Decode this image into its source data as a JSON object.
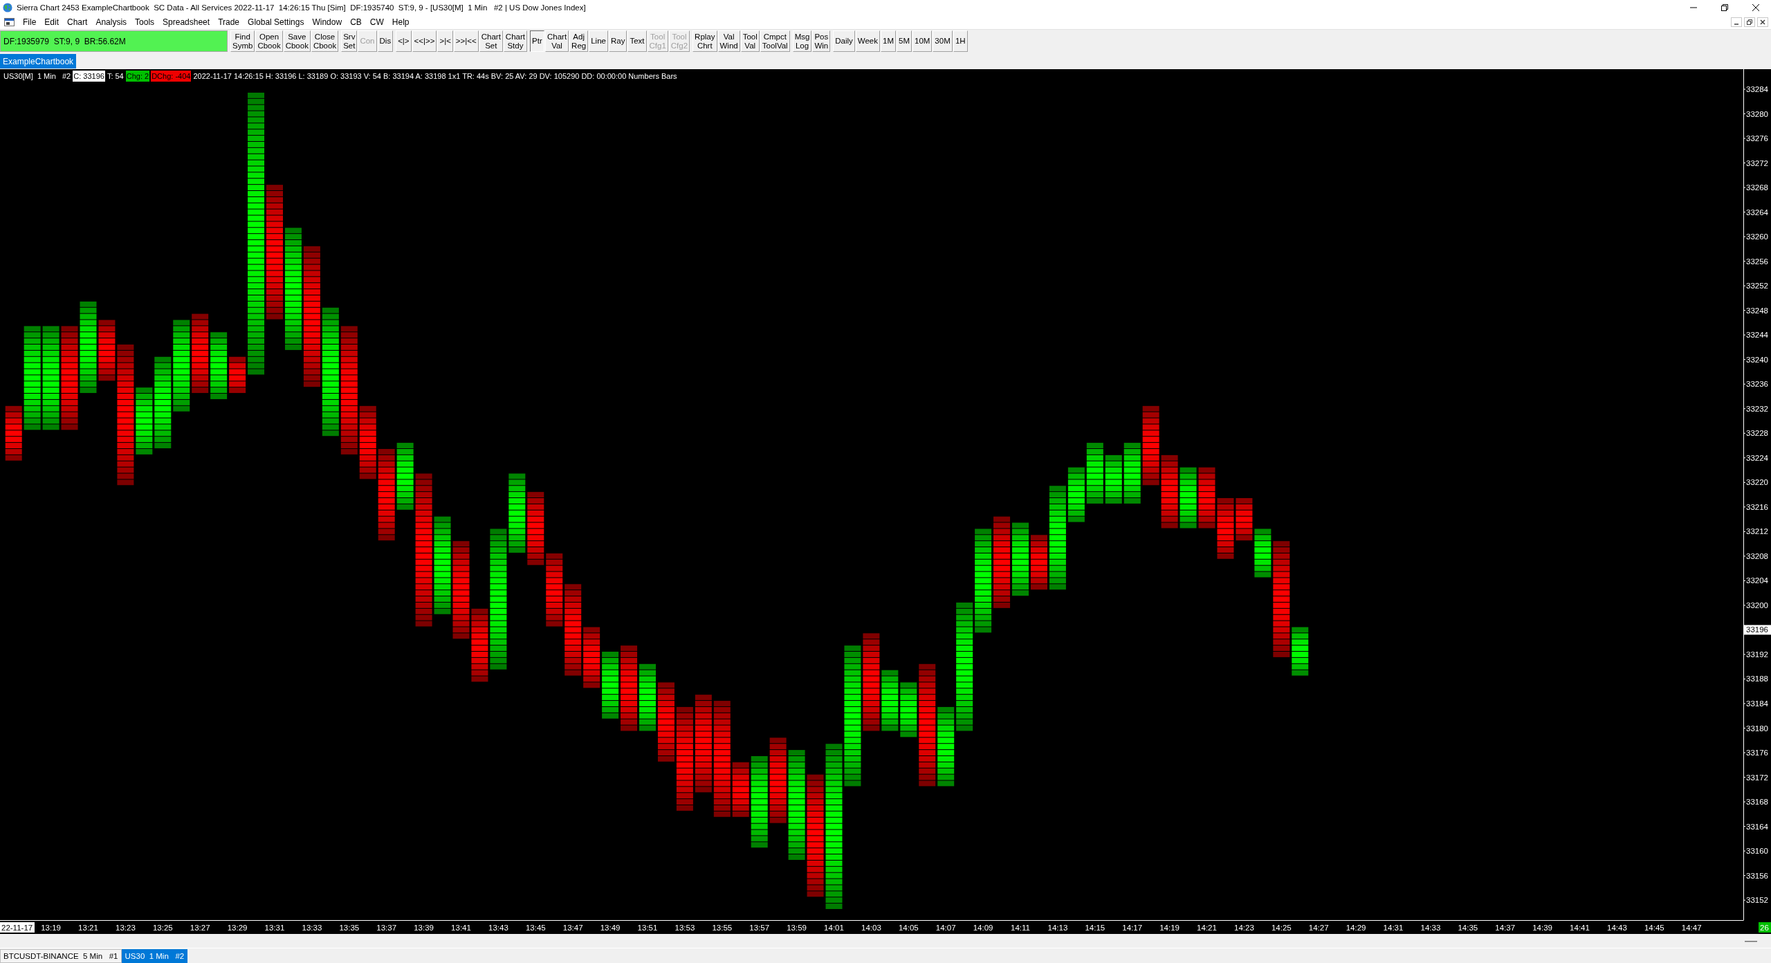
{
  "window": {
    "title": "Sierra Chart 2453 ExampleChartbook  SC Data - All Services 2022-11-17  14:26:15 Thu [Sim]  DF:1935740  ST:9, 9 - [US30[M]  1 Min   #2 | US Dow Jones Index]"
  },
  "menu_bar": [
    "File",
    "Edit",
    "Chart",
    "Analysis",
    "Tools",
    "Spreadsheet",
    "Trade",
    "Global Settings",
    "Window",
    "CB",
    "CW",
    "Help"
  ],
  "toolbar": {
    "status": "DF:1935979  ST:9, 9  BR:56.62M",
    "groups": [
      {
        "buttons": [
          {
            "label": "Find\nSymb",
            "selected": false,
            "disabled": false
          },
          {
            "label": "Open\nCbook",
            "selected": false,
            "disabled": false
          },
          {
            "label": "Save\nCbook",
            "selected": false,
            "disabled": false
          },
          {
            "label": "Close\nCbook",
            "selected": false,
            "disabled": false
          }
        ]
      },
      {
        "buttons": [
          {
            "label": "Srv\nSet",
            "selected": false,
            "disabled": false
          },
          {
            "label": "Con",
            "selected": false,
            "disabled": true
          },
          {
            "label": "Dis",
            "selected": false,
            "disabled": false
          }
        ]
      },
      {
        "buttons": [
          {
            "label": "<|>",
            "selected": false,
            "disabled": false
          },
          {
            "label": "<<|>>",
            "selected": false,
            "disabled": false
          },
          {
            "label": ">|<",
            "selected": false,
            "disabled": false
          },
          {
            "label": ">>|<<",
            "selected": false,
            "disabled": false
          },
          {
            "label": "Chart\nSet",
            "selected": false,
            "disabled": false
          },
          {
            "label": "Chart\nStdy",
            "selected": false,
            "disabled": false
          }
        ]
      },
      {
        "buttons": [
          {
            "label": "Ptr",
            "selected": true,
            "disabled": false
          },
          {
            "label": "Chart\nVal",
            "selected": false,
            "disabled": false
          },
          {
            "label": "Adj\nReg",
            "selected": false,
            "disabled": false
          },
          {
            "label": "Line",
            "selected": false,
            "disabled": false
          },
          {
            "label": "Ray",
            "selected": false,
            "disabled": false
          },
          {
            "label": "Text",
            "selected": false,
            "disabled": false
          },
          {
            "label": "Tool\nCfg1",
            "selected": false,
            "disabled": true
          },
          {
            "label": "Tool\nCfg2",
            "selected": false,
            "disabled": true
          }
        ]
      },
      {
        "buttons": [
          {
            "label": "Rplay\nChrt",
            "selected": false,
            "disabled": false
          },
          {
            "label": "Val\nWind",
            "selected": false,
            "disabled": false
          },
          {
            "label": "Tool\nVal",
            "selected": false,
            "disabled": false
          },
          {
            "label": "Cmpct\nToolVal",
            "selected": false,
            "disabled": false
          }
        ]
      },
      {
        "buttons": [
          {
            "label": "Msg\nLog",
            "selected": false,
            "disabled": false
          },
          {
            "label": "Pos\nWin",
            "selected": false,
            "disabled": false
          }
        ]
      },
      {
        "buttons": [
          {
            "label": "Daily",
            "selected": false,
            "disabled": false
          },
          {
            "label": "Week",
            "selected": false,
            "disabled": false
          },
          {
            "label": "1M",
            "selected": false,
            "disabled": false
          },
          {
            "label": "5M",
            "selected": false,
            "disabled": false
          },
          {
            "label": "10M",
            "selected": false,
            "disabled": false
          },
          {
            "label": "30M",
            "selected": false,
            "disabled": false
          },
          {
            "label": "1H",
            "selected": false,
            "disabled": false
          }
        ]
      }
    ]
  },
  "chartbook_tabs": [
    {
      "label": "ExampleChartbook",
      "selected": true
    }
  ],
  "chart": {
    "header": [
      {
        "text": "US30[M]  1 Min   #2",
        "kind": "plain"
      },
      {
        "text": "C: 33196",
        "kind": "highlight"
      },
      {
        "text": "T: 54",
        "kind": "plain"
      },
      {
        "text": "Chg: 2",
        "kind": "positive"
      },
      {
        "text": "DChg: -404",
        "kind": "negative"
      },
      {
        "text": "2022-11-17 14:26:15 H: 33196 L: 33189 O: 33193 V: 54 B: 33194 A: 33198 1x1 TR: 44s BV: 25 AV: 29 DV: 105290 DD: 00:00:00 Numbers Bars",
        "kind": "plain"
      }
    ],
    "price_axis": [
      {
        "text": "33284",
        "kind": "tick"
      },
      {
        "text": "33280",
        "kind": "tick"
      },
      {
        "text": "33276",
        "kind": "tick"
      },
      {
        "text": "33272",
        "kind": "tick"
      },
      {
        "text": "33268",
        "kind": "tick"
      },
      {
        "text": "33264",
        "kind": "tick"
      },
      {
        "text": "33260",
        "kind": "tick"
      },
      {
        "text": "33256",
        "kind": "tick"
      },
      {
        "text": "33252",
        "kind": "tick"
      },
      {
        "text": "33248",
        "kind": "tick"
      },
      {
        "text": "33244",
        "kind": "tick"
      },
      {
        "text": "33240",
        "kind": "tick"
      },
      {
        "text": "33236",
        "kind": "tick"
      },
      {
        "text": "33232",
        "kind": "tick"
      },
      {
        "text": "33228",
        "kind": "tick"
      },
      {
        "text": "33224",
        "kind": "tick"
      },
      {
        "text": "33220",
        "kind": "tick"
      },
      {
        "text": "33216",
        "kind": "tick"
      },
      {
        "text": "33212",
        "kind": "tick"
      },
      {
        "text": "33208",
        "kind": "tick"
      },
      {
        "text": "33204",
        "kind": "tick"
      },
      {
        "text": "33200",
        "kind": "tick"
      },
      {
        "text": "33196",
        "kind": "last"
      },
      {
        "text": "33192",
        "kind": "tick"
      },
      {
        "text": "33188",
        "kind": "tick"
      },
      {
        "text": "33184",
        "kind": "tick"
      },
      {
        "text": "33180",
        "kind": "tick"
      },
      {
        "text": "33176",
        "kind": "tick"
      },
      {
        "text": "33172",
        "kind": "tick"
      },
      {
        "text": "33168",
        "kind": "tick"
      },
      {
        "text": "33164",
        "kind": "tick"
      },
      {
        "text": "33160",
        "kind": "tick"
      },
      {
        "text": "33156",
        "kind": "tick"
      },
      {
        "text": "33152",
        "kind": "tick"
      }
    ],
    "time_axis": [
      "13:19",
      "13:21",
      "13:23",
      "13:25",
      "13:27",
      "13:29",
      "13:31",
      "13:33",
      "13:35",
      "13:37",
      "13:39",
      "13:41",
      "13:43",
      "13:45",
      "13:47",
      "13:49",
      "13:51",
      "13:53",
      "13:55",
      "13:57",
      "13:59",
      "14:01",
      "14:03",
      "14:05",
      "14:07",
      "14:09",
      "14:11",
      "14:13",
      "14:15",
      "14:17",
      "14:19",
      "14:21",
      "14:23",
      "14:25",
      "14:27",
      "14:29",
      "14:31",
      "14:33",
      "14:35",
      "14:37",
      "14:39",
      "14:41",
      "14:43",
      "14:45",
      "14:47"
    ],
    "date_label": "22-11-17",
    "countdown": "26"
  },
  "chart_tabs": [
    {
      "label": "BTCUSDT-BINANCE  5 Min   #1",
      "selected": false
    },
    {
      "label": "US30  1 Min   #2",
      "selected": true
    }
  ]
}
